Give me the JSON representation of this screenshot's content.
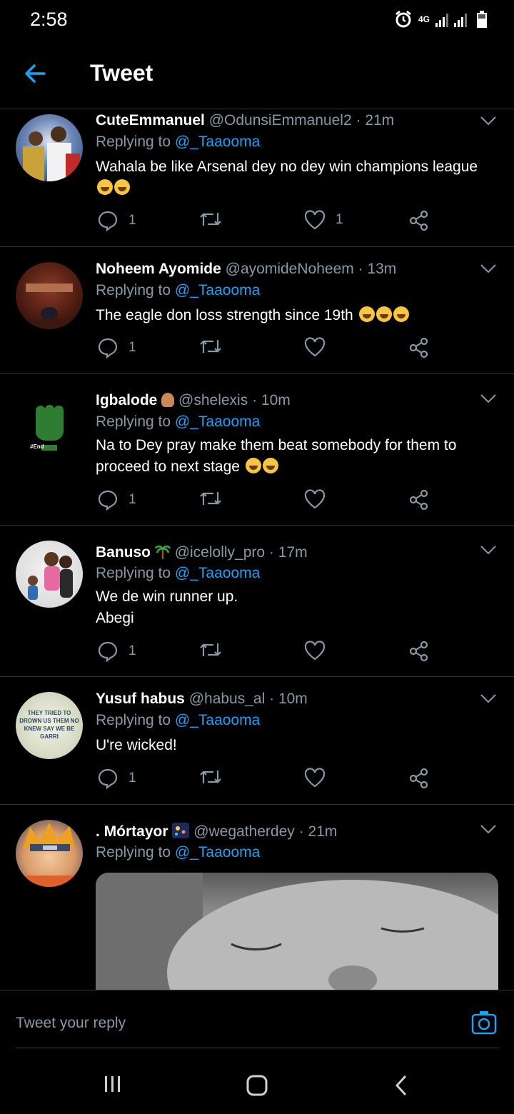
{
  "status_bar": {
    "time": "2:58",
    "network": "4G"
  },
  "header": {
    "title": "Tweet"
  },
  "tweets": [
    {
      "name": "CuteEmmanuel",
      "handle": "@OdunsiEmmanuel2",
      "time": "21m",
      "replying_label": "Replying to",
      "replying_to": "@_Taaooma",
      "text": "Wahala be like Arsenal dey no dey win champions league",
      "emoji_count": 2,
      "replies": "1",
      "retweets": "",
      "likes": "1"
    },
    {
      "name": "Noheem Ayomide",
      "handle": "@ayomideNoheem",
      "time": "13m",
      "replying_label": "Replying to",
      "replying_to": "@_Taaooma",
      "text": "The eagle don loss strength since 19th",
      "emoji_count": 3,
      "replies": "1",
      "retweets": "",
      "likes": ""
    },
    {
      "name": "Igbalode",
      "handle": "@shelexis",
      "time": "10m",
      "replying_label": "Replying to",
      "replying_to": "@_Taaooma",
      "text": "Na to Dey pray make them beat somebody for them to proceed to next stage",
      "emoji_count": 2,
      "replies": "1",
      "retweets": "",
      "likes": ""
    },
    {
      "name": "Banuso",
      "handle": "@icelolly_pro",
      "time": "17m",
      "replying_label": "Replying to",
      "replying_to": "@_Taaooma",
      "text": "We de win runner up.\nAbegi",
      "emoji_count": 0,
      "replies": "1",
      "retweets": "",
      "likes": ""
    },
    {
      "name": "Yusuf habus",
      "handle": "@habus_al",
      "time": "10m",
      "replying_label": "Replying to",
      "replying_to": "@_Taaooma",
      "text": "U're wicked!",
      "emoji_count": 0,
      "replies": "1",
      "retweets": "",
      "likes": "",
      "avatar_text": "THEY TRIED TO DROWN US THEM NO KNEW SAY WE BE GARRI"
    },
    {
      "name": ". Mórtayor",
      "handle": "@wegatherdey",
      "time": "21m",
      "replying_label": "Replying to",
      "replying_to": "@_Taaooma",
      "text": "",
      "emoji_count": 0,
      "replies": "",
      "retweets": "",
      "likes": ""
    }
  ],
  "avatar_captions": {
    "igbalode": "#End"
  },
  "composer": {
    "placeholder": "Tweet your reply"
  },
  "colors": {
    "background": "#000000",
    "accent": "#1da1f2",
    "secondary_text": "#8899a6",
    "divider": "#2f3336"
  },
  "icons": [
    "arrow-left-icon",
    "chevron-down-icon",
    "reply-icon",
    "retweet-icon",
    "heart-icon",
    "share-icon",
    "camera-icon",
    "recents-icon",
    "home-icon",
    "back-icon"
  ]
}
